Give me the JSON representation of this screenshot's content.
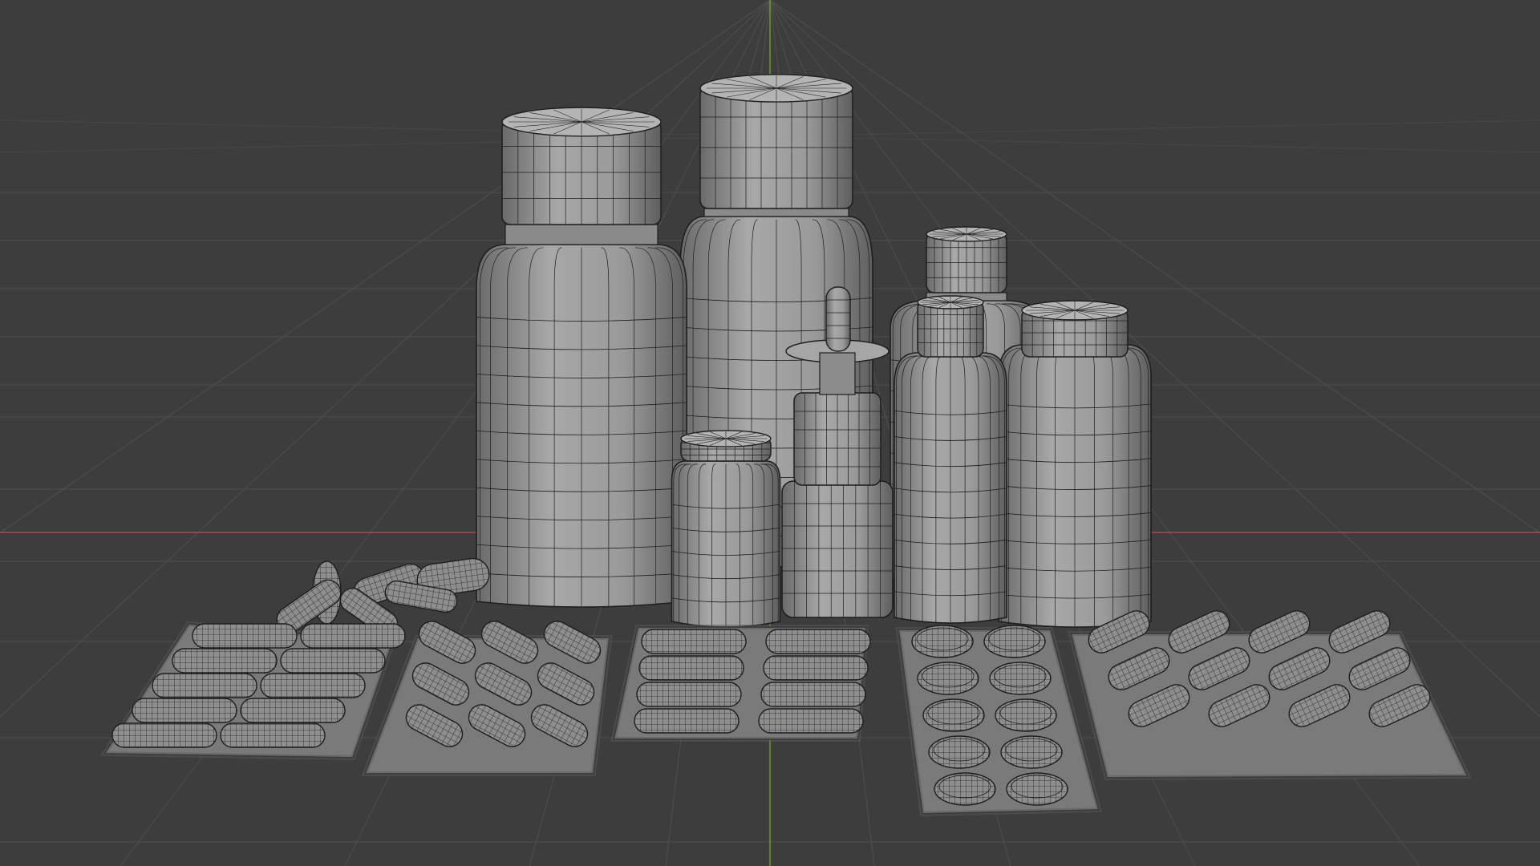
{
  "viewport": {
    "view": "3D Viewport",
    "background": "#3d3d3d",
    "grid_color": "#4d4d4d",
    "x_axis_color": "#b0474d",
    "y_axis_color": "#6b9a3a",
    "mesh_fill": "#9c9c9c",
    "mesh_shadow": "#6f6f6f",
    "wire_color": "#1e1e1e"
  },
  "scene": {
    "bottle_count": 7,
    "blister_pack_count": 5,
    "loose_capsule_count": 6
  }
}
